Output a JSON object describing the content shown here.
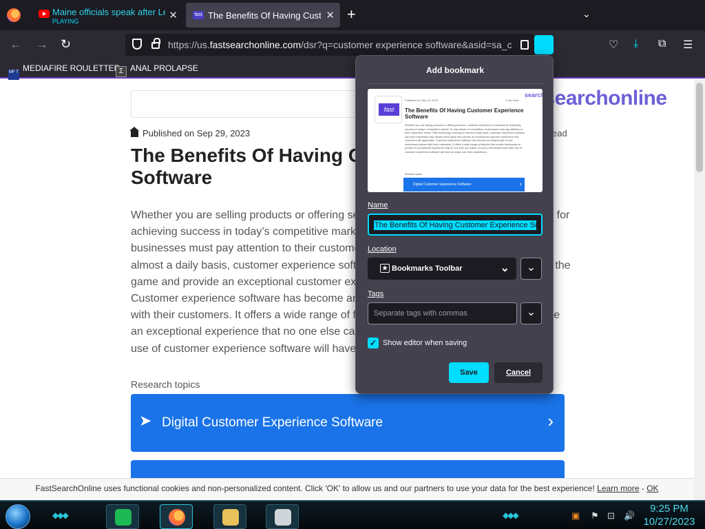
{
  "tabs": [
    {
      "title": "Maine officials speak after Lewiston",
      "status": "PLAYING",
      "icon": "youtube-icon"
    },
    {
      "title": "The Benefits Of Having Customer Experience Software",
      "icon": "fastsearch-icon"
    }
  ],
  "toolbar": {
    "url_prefix": "https://us.",
    "url_host": "fastsearchonline.com",
    "url_path": "/dsr?q=customer experience software&asid=sa_ch&"
  },
  "bookmarks_bar": [
    {
      "label": "MEDIAFIRE ROULETTER"
    },
    {
      "label": "ANAL PROLAPSE"
    }
  ],
  "article": {
    "brand": "searchonline",
    "brand_mark": "t",
    "published": "Published on Sep 29, 2023",
    "read_suffix": "ead",
    "title": "The Benefits Of Having Customer Experience Software",
    "body": "Whether you are selling products or offering services, customer experience is essential for achieving success in today’s competitive market. To stay ahead of competitors, businesses must pay attention to their customers’ needs. With technology evolving on almost a daily basis, customer experience software can help businesses stay ahead of the game and provide an exceptional customer experience that customers will appreciate. Customer experience software has become an integral part of how businesses interact with their customers. It offers a wide range of features that enable businesses to provide an exceptional experience that no one else can match. As such, businesses that make use of customer experience software will have an edge over their competitors.",
    "research_label": "Research topics",
    "topics": [
      "Digital Customer Experience Software",
      ""
    ]
  },
  "cookie": {
    "text": "FastSearchOnline uses functional cookies and non-personalized content. Click 'OK' to allow us and our partners to use your data for the best experience!",
    "learn_more": "Learn more",
    "separator": "-",
    "ok": "OK"
  },
  "dialog": {
    "title": "Add bookmark",
    "name_label": "Name",
    "name_value": "The Benefits Of Having Customer Experience Software",
    "location_label": "Location",
    "location_value": "Bookmarks Toolbar",
    "tags_label": "Tags",
    "tags_placeholder": "Separate tags with commas",
    "show_editor_label": "Show editor when saving",
    "show_editor_checked": true,
    "save_label": "Save",
    "cancel_label": "Cancel",
    "preview": {
      "meta": "Published on Sep 29, 2023",
      "meta_right": "2 min read",
      "brand": "search",
      "title": "The Benefits Of Having Customer Experience Software",
      "text": "Whether you are selling products or offering services, customer experience is essential for achieving success in today's competitive market. To stay ahead of competitors, businesses must pay attention to their customers' needs. With technology evolving on almost a daily basis, customer experience software can help businesses stay ahead of the game and provide an exceptional customer experience that customers will appreciate. Customer experience software has become an integral part of how businesses interact with their customers. It offers a wide range of features that enable businesses to provide an exceptional experience that no one else can match. As such, businesses that make use of customer experience software will have an edge over their competitors.",
      "research": "Research topics",
      "topic": "Digital Customer Experience Software"
    }
  },
  "taskbar": {
    "time": "9:25 PM",
    "date": "10/27/2023"
  },
  "colors": {
    "accent": "#00ddff",
    "topic_blue": "#1a73e8",
    "brand_purple": "#6d5fd6",
    "chrome_dark": "#1c1b22"
  }
}
